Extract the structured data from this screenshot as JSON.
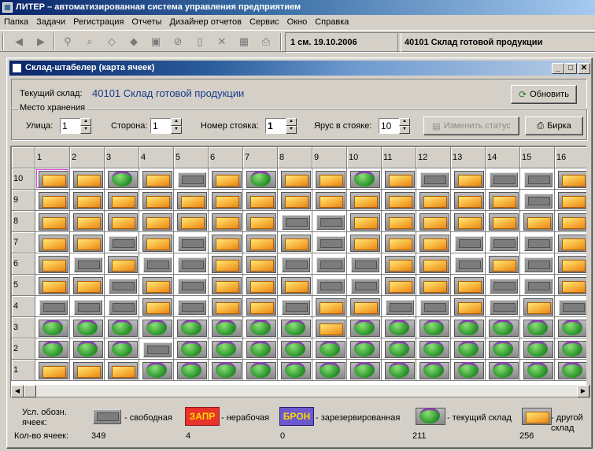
{
  "app": {
    "title": "ЛИТЕР – автоматизированная система управления предприятием"
  },
  "menu": [
    "Папка",
    "Задачи",
    "Регистрация",
    "Отчеты",
    "Дизайнер отчетов",
    "Сервис",
    "Окно",
    "Справка"
  ],
  "toolbar": {
    "icons": [
      "arrow-left-icon",
      "arrow-right-icon",
      "filter-icon",
      "binoculars-icon",
      "tag-icon",
      "tag-fill-icon",
      "save-icon",
      "cancel-icon",
      "new-document-icon",
      "delete-icon",
      "calculator-icon",
      "print-icon"
    ],
    "shift": "1 см. 19.10.2006",
    "warehouse": "40101 Склад готовой продукции"
  },
  "window": {
    "title": "Склад-штабелер (карта ячеек)"
  },
  "current": {
    "label": "Текущий склад:",
    "value": "40101 Склад готовой продукции"
  },
  "refresh_label": "Обновить",
  "storage": {
    "legend": "Место хранения",
    "street_label": "Улица:",
    "street_value": "1",
    "side_label": "Сторона:",
    "side_value": "1",
    "rack_label": "Номер стояка:",
    "rack_value": "1",
    "tier_label": "Ярус в стояке:",
    "tier_value": "10",
    "change_status_label": "Изменить статус",
    "tag_label": "Бирка"
  },
  "grid": {
    "columns": [
      "1",
      "2",
      "3",
      "4",
      "5",
      "6",
      "7",
      "8",
      "9",
      "10",
      "11",
      "12",
      "13",
      "14",
      "15",
      "16"
    ],
    "rows": [
      {
        "label": "10",
        "cells": [
          "o",
          "o",
          "c",
          "o",
          "f",
          "o",
          "c",
          "o",
          "o",
          "c",
          "o",
          "f",
          "o",
          "f",
          "f",
          "o"
        ]
      },
      {
        "label": "9",
        "cells": [
          "o",
          "o",
          "o",
          "o",
          "o",
          "o",
          "o",
          "o",
          "o",
          "o",
          "o",
          "o",
          "o",
          "o",
          "f",
          "o"
        ]
      },
      {
        "label": "8",
        "cells": [
          "o",
          "o",
          "o",
          "o",
          "o",
          "o",
          "o",
          "f",
          "f",
          "o",
          "o",
          "o",
          "o",
          "o",
          "o",
          "o"
        ]
      },
      {
        "label": "7",
        "cells": [
          "o",
          "o",
          "f",
          "o",
          "f",
          "o",
          "o",
          "o",
          "f",
          "o",
          "o",
          "o",
          "f",
          "f",
          "f",
          "o"
        ]
      },
      {
        "label": "6",
        "cells": [
          "o",
          "f",
          "o",
          "f",
          "f",
          "o",
          "o",
          "f",
          "f",
          "f",
          "o",
          "o",
          "f",
          "o",
          "f",
          "o"
        ]
      },
      {
        "label": "5",
        "cells": [
          "o",
          "o",
          "f",
          "o",
          "f",
          "o",
          "o",
          "o",
          "f",
          "f",
          "o",
          "o",
          "o",
          "f",
          "f",
          "o"
        ]
      },
      {
        "label": "4",
        "cells": [
          "f",
          "f",
          "f",
          "o",
          "f",
          "o",
          "o",
          "f",
          "o",
          "o",
          "f",
          "f",
          "o",
          "f",
          "o",
          "f"
        ]
      },
      {
        "label": "3",
        "cells": [
          "c",
          "c",
          "c",
          "c",
          "c",
          "c",
          "c",
          "c",
          "o",
          "c",
          "c",
          "c",
          "c",
          "c",
          "c",
          "c"
        ]
      },
      {
        "label": "2",
        "cells": [
          "c",
          "c",
          "c",
          "f",
          "c",
          "c",
          "c",
          "c",
          "c",
          "c",
          "c",
          "c",
          "c",
          "c",
          "c",
          "c"
        ]
      },
      {
        "label": "1",
        "cells": [
          "o",
          "o",
          "o",
          "c",
          "c",
          "c",
          "c",
          "c",
          "c",
          "c",
          "c",
          "c",
          "c",
          "c",
          "c",
          "c"
        ]
      }
    ]
  },
  "legend": {
    "title": "Усл. обозн. ячеек:",
    "count_label": "Кол-во ячеек:",
    "free_label": "- свободная",
    "free_count": "349",
    "broken_tag": "ЗАПР",
    "broken_label": "- нерабочая",
    "broken_count": "4",
    "reserved_tag": "БРОН",
    "reserved_label": "- зарезервированная",
    "reserved_count": "0",
    "current_label": "- текущий склад",
    "current_count": "211",
    "other_label": "- другой склад",
    "other_count": "256",
    "colors": {
      "broken_bg": "#e8322a",
      "broken_fg": "#ffd800",
      "reserved_bg": "#6a5acd",
      "reserved_fg": "#ffd800"
    }
  }
}
